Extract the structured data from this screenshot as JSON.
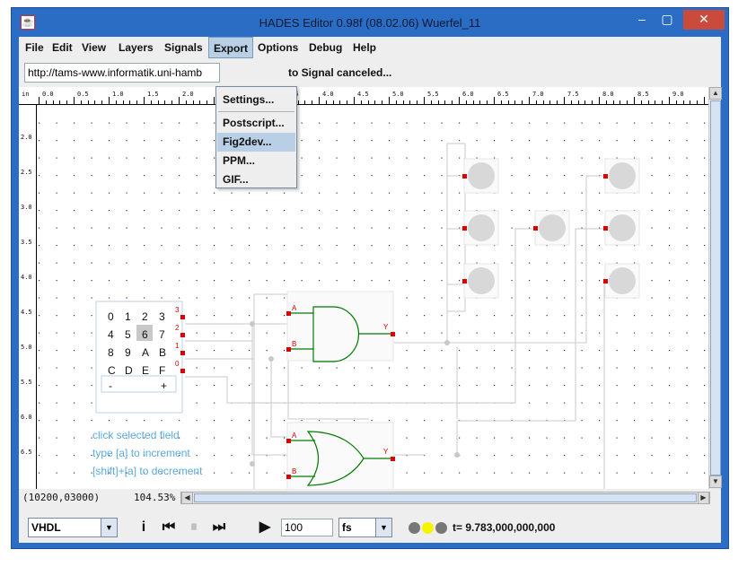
{
  "window": {
    "title": "HADES Editor 0.98f (08.02.06)   Wuerfel_11",
    "controls": {
      "minimize": "–",
      "maximize": "▢",
      "close": "✕"
    }
  },
  "menubar": [
    "File",
    "Edit",
    "View",
    "Layers",
    "Signals",
    "Export",
    "Options",
    "Debug",
    "Help"
  ],
  "url_field": "http://tams-www.informatik.uni-hamb",
  "status_message": "to Signal canceled...",
  "export_menu": {
    "items": [
      "Settings...",
      "Postscript...",
      "Fig2dev...",
      "PPM...",
      "GIF..."
    ],
    "highlighted": "Fig2dev..."
  },
  "ruler_top": [
    "in",
    "0.0",
    "0.5",
    "1.0",
    "1.5",
    "2.0",
    "2.5",
    "3.0",
    "3.5",
    "4.0",
    "4.5",
    "5.0",
    "5.5",
    "6.0",
    "6.5",
    "7.0",
    "7.5",
    "8.0",
    "8.5",
    "9.0"
  ],
  "ruler_left": [
    "2.0",
    "2.5",
    "3.0",
    "3.5",
    "4.0",
    "4.5",
    "5.0",
    "5.5",
    "6.0",
    "6.5"
  ],
  "hex_switch": {
    "rows": [
      [
        "0",
        "1",
        "2",
        "3"
      ],
      [
        "4",
        "5",
        "6",
        "7"
      ],
      [
        "8",
        "9",
        "A",
        "B"
      ],
      [
        "C",
        "D",
        "E",
        "F"
      ]
    ],
    "selected": "6",
    "minus": "-",
    "plus": "+",
    "pins": [
      "3",
      "2",
      "1",
      "0"
    ]
  },
  "instructions": [
    "click selected field",
    "type [a] to increment",
    "[shift]+[a] to decrement"
  ],
  "gates": {
    "and": {
      "inputs": [
        "A",
        "B"
      ],
      "output": "Y"
    },
    "or": {
      "inputs": [
        "A",
        "B"
      ],
      "output": "Y"
    }
  },
  "colors": {
    "wire": "#c8c8c8",
    "gate": "#007a00",
    "pin": "#dd0000",
    "led_off": "#d8d8d8",
    "instruction_text": "#5ba8e0",
    "title_bar": "#2b6cc4"
  },
  "coords_readout": "(10200,03000)",
  "zoom_readout": "104.53%",
  "simulator": {
    "language": "VHDL",
    "info_icon": "i",
    "steps_value": "100",
    "time_unit": "fs",
    "leds": [
      "#777777",
      "#f5f500",
      "#777777"
    ],
    "time": "t= 9.783,000,000,000"
  }
}
